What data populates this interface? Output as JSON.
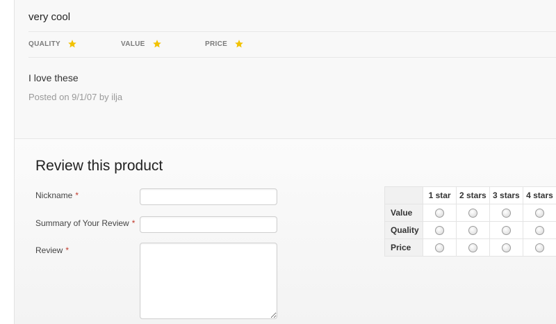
{
  "review": {
    "title": "very cool",
    "ratings": [
      {
        "label": "QUALITY",
        "stars": 1,
        "icon": "star-icon"
      },
      {
        "label": "VALUE",
        "stars": 1,
        "icon": "star-icon"
      },
      {
        "label": "PRICE",
        "stars": 1,
        "icon": "star-icon"
      }
    ],
    "body": "I love these",
    "meta": "Posted on 9/1/07 by ilja"
  },
  "form": {
    "heading": "Review this product",
    "required_marker": "*",
    "fields": {
      "nickname": {
        "label": "Nickname",
        "value": ""
      },
      "summary": {
        "label": "Summary of Your Review",
        "value": ""
      },
      "review": {
        "label": "Review",
        "value": ""
      }
    },
    "rating_table": {
      "columns": [
        "1 star",
        "2 stars",
        "3 stars",
        "4 stars"
      ],
      "rows": [
        "Value",
        "Quality",
        "Price"
      ]
    }
  },
  "colors": {
    "star": "#f2c200",
    "required": "#c0392b"
  }
}
